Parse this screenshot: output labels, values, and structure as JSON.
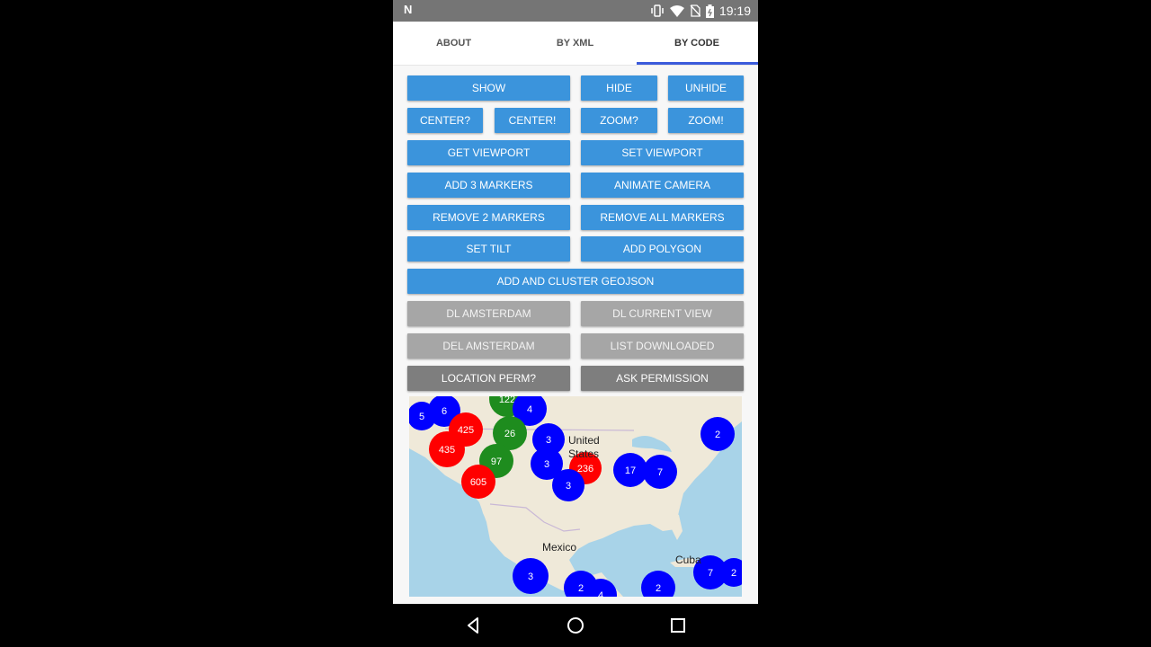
{
  "status_bar": {
    "time": "19:19",
    "icons": [
      "n-logo-icon",
      "vibrate-icon",
      "wifi-icon",
      "no-sim-icon",
      "battery-icon"
    ]
  },
  "tabs": [
    {
      "label": "ABOUT"
    },
    {
      "label": "BY XML"
    },
    {
      "label": "BY CODE",
      "active": true
    }
  ],
  "buttons": {
    "show": "SHOW",
    "hide": "HIDE",
    "unhide": "UNHIDE",
    "center_q": "CENTER?",
    "center_x": "CENTER!",
    "zoom_q": "ZOOM?",
    "zoom_x": "ZOOM!",
    "get_viewport": "GET VIEWPORT",
    "set_viewport": "SET VIEWPORT",
    "add_3_markers": "ADD 3 MARKERS",
    "animate_camera": "ANIMATE CAMERA",
    "remove_2_markers": "REMOVE 2 MARKERS",
    "remove_all_markers": "REMOVE ALL MARKERS",
    "set_tilt": "SET TILT",
    "add_polygon": "ADD POLYGON",
    "add_cluster_geojson": "ADD AND CLUSTER GEOJSON",
    "dl_amsterdam": "DL AMSTERDAM",
    "dl_current_view": "DL CURRENT VIEW",
    "del_amsterdam": "DEL AMSTERDAM",
    "list_downloaded": "LIST DOWNLOADED",
    "location_perm": "LOCATION PERM?",
    "ask_permission": "ASK PERMISSION"
  },
  "map": {
    "labels": {
      "united": "United",
      "states": "States",
      "mexico": "Mexico",
      "cuba": "Cuba"
    },
    "clusters": [
      {
        "count": "5",
        "color": "blue"
      },
      {
        "count": "6",
        "color": "blue"
      },
      {
        "count": "122",
        "color": "green"
      },
      {
        "count": "4",
        "color": "blue"
      },
      {
        "count": "425",
        "color": "red"
      },
      {
        "count": "26",
        "color": "green"
      },
      {
        "count": "3",
        "color": "blue"
      },
      {
        "count": "2",
        "color": "blue"
      },
      {
        "count": "435",
        "color": "red"
      },
      {
        "count": "97",
        "color": "green"
      },
      {
        "count": "3",
        "color": "blue"
      },
      {
        "count": "236",
        "color": "red"
      },
      {
        "count": "17",
        "color": "blue"
      },
      {
        "count": "7",
        "color": "blue"
      },
      {
        "count": "605",
        "color": "red"
      },
      {
        "count": "3",
        "color": "blue"
      },
      {
        "count": "3",
        "color": "blue"
      },
      {
        "count": "2",
        "color": "blue"
      },
      {
        "count": "4",
        "color": "blue"
      },
      {
        "count": "2",
        "color": "blue"
      },
      {
        "count": "7",
        "color": "blue"
      },
      {
        "count": "2",
        "color": "blue"
      }
    ],
    "colors": {
      "blue": "#0000ff",
      "green": "#1e8c1e",
      "red": "#ff0000",
      "water": "#a8d3e8",
      "land": "#efe9d9"
    }
  },
  "nav_bar": {
    "icons": [
      "back-icon",
      "home-icon",
      "recents-icon"
    ]
  }
}
